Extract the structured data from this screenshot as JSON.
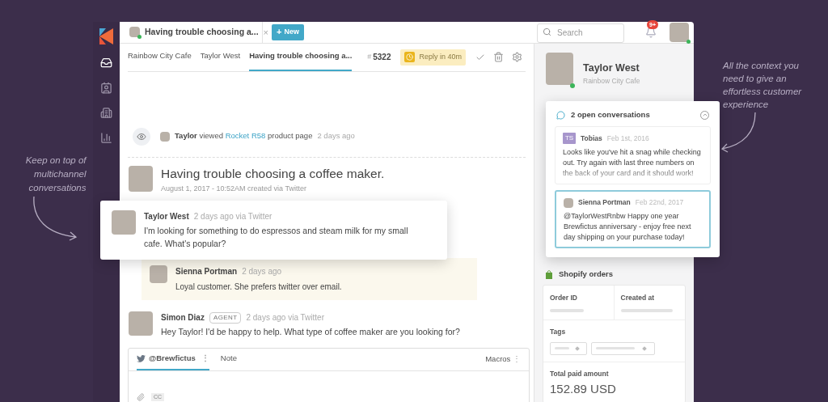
{
  "annotations": [
    {
      "text": "Keep on top of multichannel conversations"
    },
    {
      "text": "All the context you need to give an effortless customer experience"
    }
  ],
  "nav": [
    {
      "kind": "inbox",
      "selected": true
    },
    {
      "kind": "contacts",
      "selected": false
    },
    {
      "kind": "companies",
      "selected": false
    },
    {
      "kind": "reports",
      "selected": false
    }
  ],
  "open_tab": {
    "title": "Having trouble choosing a...",
    "close": "×"
  },
  "new_button": {
    "icon": "+",
    "label": "New"
  },
  "search": {
    "placeholder": "Search"
  },
  "notifications": {
    "badge": "9+"
  },
  "breadcrumbs": [
    {
      "label": "Rainbow City Cafe",
      "selected": false
    },
    {
      "label": "Taylor West",
      "selected": false
    },
    {
      "label": "Having trouble choosing a...",
      "selected": true
    }
  ],
  "ticket": {
    "hash": "#",
    "number": "5322",
    "sla": "Reply in 40m"
  },
  "activity": {
    "actor": "Taylor",
    "verb": "viewed",
    "link": "Rocket R58",
    "object": "product page",
    "time": "2 days ago"
  },
  "conversation": {
    "title": "Having trouble choosing a coffee maker.",
    "meta": "August 1, 2017 - 10:52AM created via Twitter"
  },
  "messages": [
    {
      "kind": "message",
      "author": "Taylor West",
      "time": "2 days ago via Twitter",
      "text": "I'm looking for something to do espressos and steam milk for my small cafe. What's popular?"
    },
    {
      "kind": "note",
      "author": "Sienna Portman",
      "time": "2 days ago",
      "text": "Loyal customer. She prefers twitter over email."
    },
    {
      "kind": "message",
      "author": "Simon Diaz",
      "badge": "AGENT",
      "time": "2 days ago via Twitter",
      "text": "Hey Taylor! I'd be happy to help. What type of coffee maker are you looking for?"
    }
  ],
  "composer": {
    "channels": [
      {
        "kind": "twitter",
        "label": "@Brewfictus",
        "menu": "⋮",
        "selected": true
      },
      {
        "kind": "note",
        "label": "Note",
        "selected": false
      }
    ],
    "macros": "Macros",
    "macros_menu": "⋮",
    "cc": "CC"
  },
  "customer": {
    "name": "Taylor West",
    "company": "Rainbow City Cafe"
  },
  "open_conversations": {
    "title": "2 open conversations",
    "items": [
      {
        "kind": "initials",
        "initials": "TS",
        "author": "Tobias",
        "date": "Feb 1st, 2016",
        "text": "Looks like you've hit a snag while checking out. Try again with last three numbers on the back of your card and it should work!",
        "selected": false
      },
      {
        "kind": "avatar",
        "author": "Sienna Portman",
        "date": "Feb 22nd, 2017",
        "text": "@TaylorWestRnbw Happy one year Brewfictus anniversary - enjoy free next day shipping on your purchase today!",
        "selected": true
      }
    ]
  },
  "shopify": {
    "title": "Shopify orders",
    "order_id": "Order ID",
    "created_at": "Created at",
    "tags": "Tags",
    "total_label": "Total paid amount",
    "total": "152.89 USD"
  }
}
